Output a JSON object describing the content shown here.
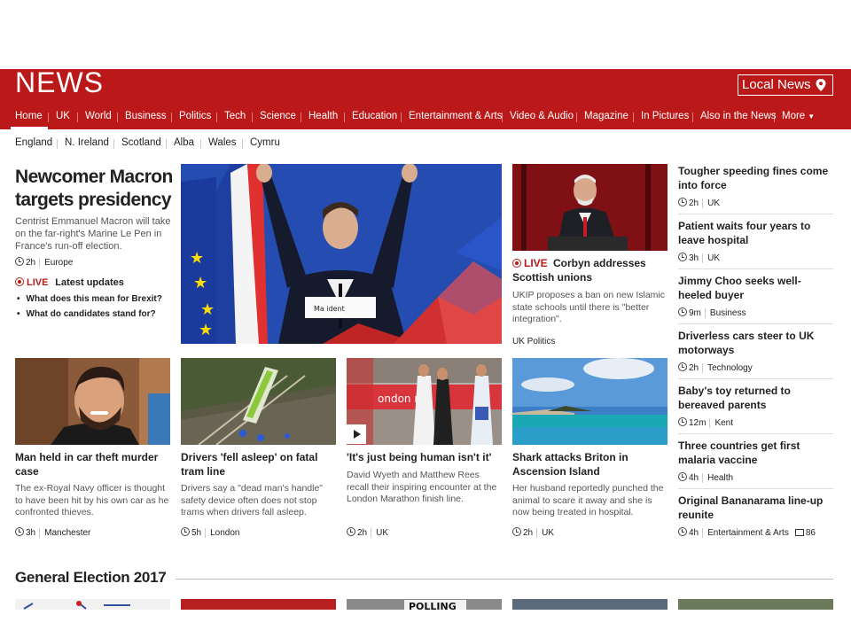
{
  "header": {
    "logo": "NEWS",
    "local_news": "Local News"
  },
  "nav": [
    "Home",
    "UK",
    "World",
    "Business",
    "Politics",
    "Tech",
    "Science",
    "Health",
    "Education",
    "Entertainment & Arts",
    "Video & Audio",
    "Magazine",
    "In Pictures",
    "Also in the News",
    "More"
  ],
  "subnav": [
    "England",
    "N. Ireland",
    "Scotland",
    "Alba",
    "Wales",
    "Cymru"
  ],
  "lead": {
    "title": "Newcomer Macron targets presidency",
    "summary": "Centrist Emmanuel Macron will take on the far-right's Marine Le Pen in France's run-off election.",
    "time": "2h",
    "section": "Europe",
    "live_label": "LIVE",
    "live_text": "Latest updates",
    "bullets": [
      "What does this mean for Brexit?",
      "What do candidates stand for?"
    ],
    "podium_text": "Ma       ident"
  },
  "corbyn": {
    "live_label": "LIVE",
    "title_rest": "Corbyn addresses Scottish unions",
    "summary": "UKIP proposes a ban on new Islamic state schools until there is \"better integration\".",
    "section": "UK Politics"
  },
  "stories": [
    {
      "title": "Man held in car theft murder case",
      "summary": "The ex-Royal Navy officer is thought to have been hit by his own car as he confronted thieves.",
      "time": "3h",
      "section": "Manchester"
    },
    {
      "title": "Drivers 'fell asleep' on fatal tram line",
      "summary": "Drivers say a \"dead man's handle\" safety device often does not stop trams when drivers fall asleep.",
      "time": "5h",
      "section": "London"
    },
    {
      "title": "'It's just being human isn't it'",
      "summary": "David Wyeth and Matthew Rees recall their inspiring encounter at the London Marathon finish line.",
      "time": "2h",
      "section": "UK",
      "banner_text": "ondon ma"
    },
    {
      "title": "Shark attacks Briton in Ascension Island",
      "summary": "Her husband reportedly punched the animal to scare it away and she is now being treated in hospital.",
      "time": "2h",
      "section": "UK"
    }
  ],
  "right_column": [
    {
      "title": "Tougher speeding fines come into force",
      "time": "2h",
      "section": "UK"
    },
    {
      "title": "Patient waits four years to leave hospital",
      "time": "3h",
      "section": "UK"
    },
    {
      "title": "Jimmy Choo seeks well-heeled buyer",
      "time": "9m",
      "section": "Business"
    },
    {
      "title": "Driverless cars steer to UK motorways",
      "time": "2h",
      "section": "Technology"
    },
    {
      "title": "Baby's toy returned to bereaved parents",
      "time": "12m",
      "section": "Kent"
    },
    {
      "title": "Three countries get first malaria vaccine",
      "time": "4h",
      "section": "Health"
    },
    {
      "title": "Original Bananarama line-up reunite",
      "time": "4h",
      "section": "Entertainment & Arts",
      "comments": "86"
    }
  ],
  "section_heading": "General Election 2017",
  "peek_text": "POLLING",
  "colors": {
    "brand": "#bb1919",
    "live": "#bb1919"
  }
}
